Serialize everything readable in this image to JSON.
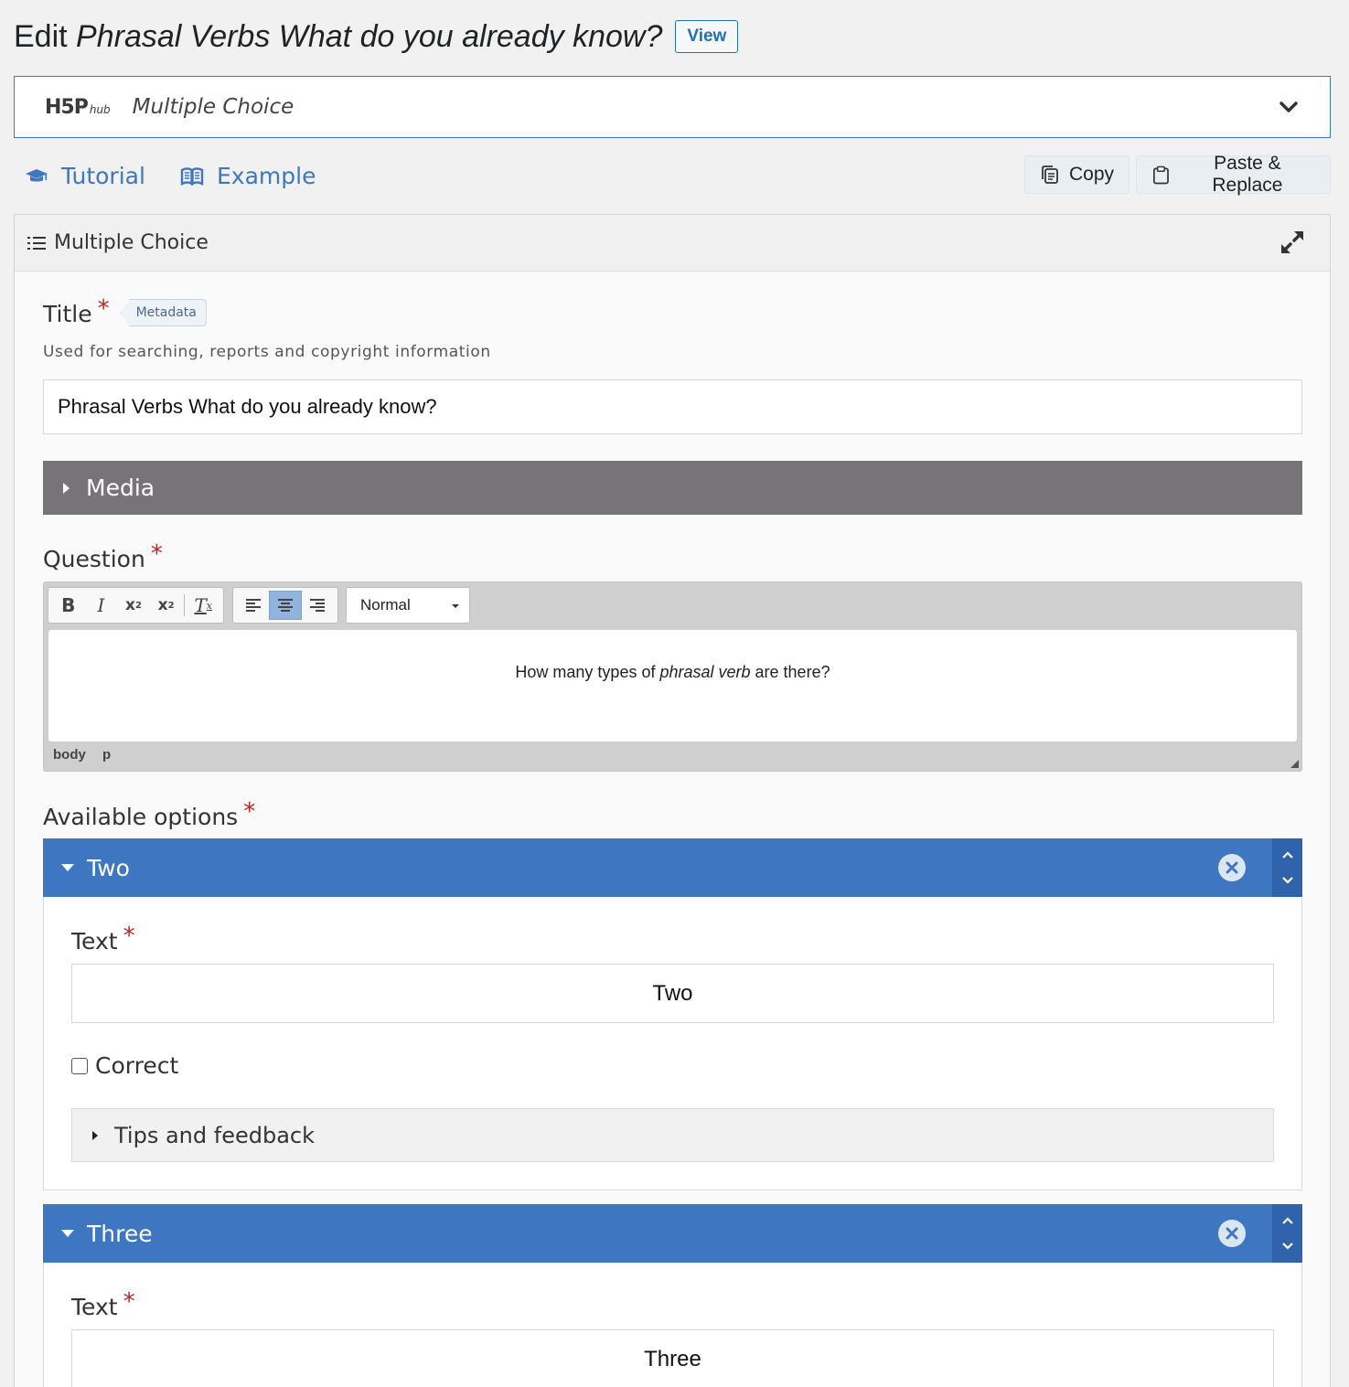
{
  "header": {
    "edit_label": "Edit",
    "content_title": "Phrasal Verbs What do you already know?",
    "view_button": "View"
  },
  "hub": {
    "logo_text": "H5P",
    "logo_sub": "hub",
    "content_type": "Multiple Choice"
  },
  "links": {
    "tutorial": "Tutorial",
    "example": "Example",
    "copy": "Copy",
    "paste_replace": "Paste & Replace"
  },
  "editor": {
    "header_title": "Multiple Choice",
    "title_field": {
      "label": "Title",
      "required_mark": "*",
      "metadata_button": "Metadata",
      "description": "Used for searching, reports and copyright information",
      "value": "Phrasal Verbs What do you already know?"
    },
    "media": {
      "label": "Media"
    },
    "question": {
      "label": "Question",
      "required_mark": "*",
      "format_select": "Normal",
      "text_before": "How many types of ",
      "text_italic": "phrasal verb",
      "text_after": " are there?",
      "path": [
        "body",
        "p"
      ]
    },
    "options": {
      "label": "Available options",
      "required_mark": "*",
      "items": [
        {
          "title": "Two",
          "text_label": "Text",
          "text_value": "Two",
          "correct_label": "Correct",
          "tips_label": "Tips and feedback"
        },
        {
          "title": "Three",
          "text_label": "Text",
          "text_value": "Three"
        }
      ]
    }
  },
  "colors": {
    "accent_blue": "#3e76c2",
    "media_gray": "#767476",
    "required_red": "#c92020"
  }
}
